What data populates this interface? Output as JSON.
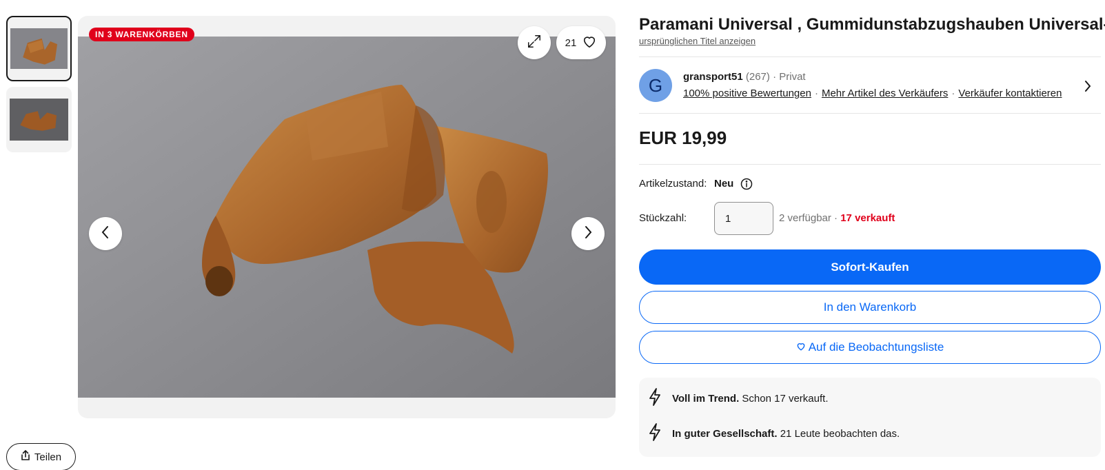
{
  "gallery": {
    "badge": "IN 3 WARENKÖRBEN",
    "watch_count": "21",
    "thumbnails": [
      {
        "label": "thumbnail-1",
        "active": true
      },
      {
        "label": "thumbnail-2",
        "active": false
      }
    ]
  },
  "share": {
    "label": "Teilen"
  },
  "listing": {
    "title": "Paramani Universal , Gummidunstabzugshauben Universal-",
    "original_title_link": "ursprünglichen Titel anzeigen"
  },
  "seller": {
    "avatar_letter": "G",
    "name": "gransport51",
    "rating_count": "(267)",
    "type": "· Privat",
    "positive_feedback": "100% positive Bewertungen",
    "more_items": "Mehr Artikel des Verkäufers",
    "contact": "Verkäufer kontaktieren"
  },
  "price": {
    "value": "EUR 19,99"
  },
  "condition": {
    "label": "Artikelzustand:",
    "value": "Neu"
  },
  "quantity": {
    "label": "Stückzahl:",
    "value": "1",
    "available": "2 verfügbar · ",
    "sold": "17 verkauft"
  },
  "actions": {
    "buy_now": "Sofort-Kaufen",
    "add_to_cart": "In den Warenkorb",
    "watch": "Auf die Beobachtungsliste"
  },
  "trends": [
    {
      "title": "Voll im Trend.",
      "text": " Schon 17 verkauft."
    },
    {
      "title": "In guter Gesellschaft.",
      "text": " 21 Leute beobachten das."
    }
  ],
  "colors": {
    "primary_blue": "#0968f6",
    "badge_red": "#e0001b",
    "sold_red": "#e0001b",
    "avatar_blue": "#6fa0e6"
  }
}
